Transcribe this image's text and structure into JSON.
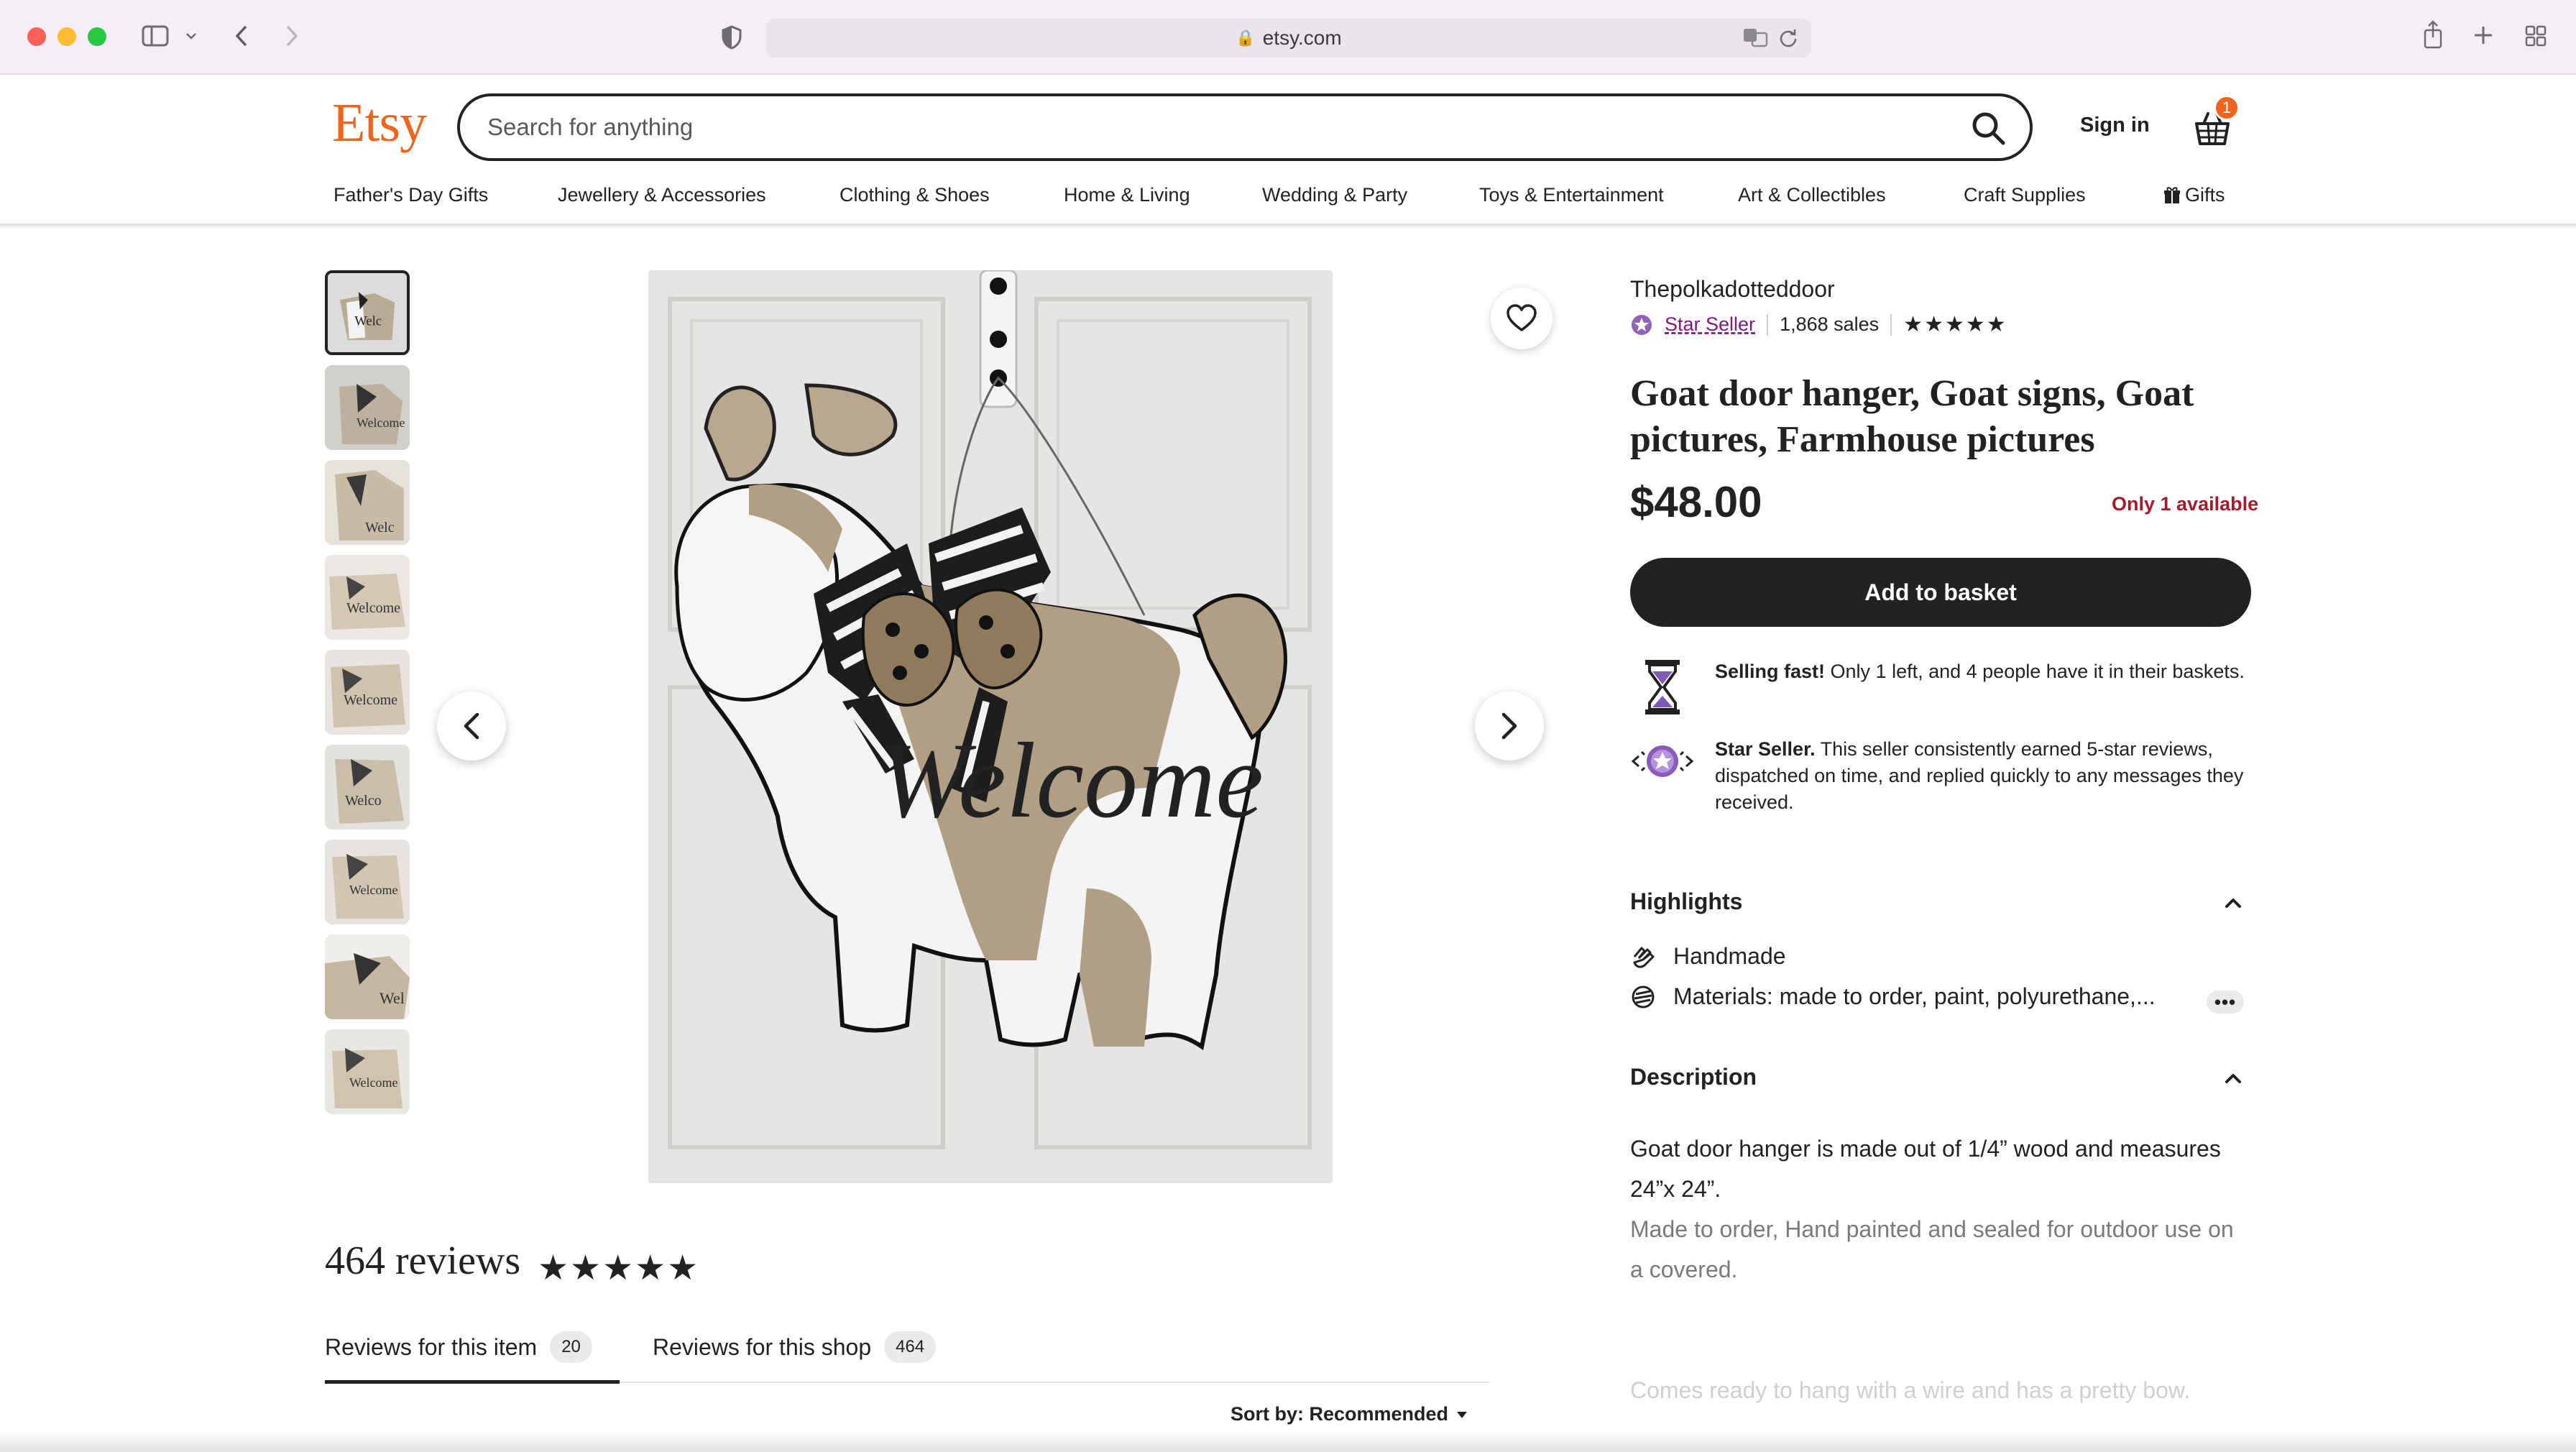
{
  "browser": {
    "url": "etsy.com"
  },
  "header": {
    "logo": "Etsy",
    "search_placeholder": "Search for anything",
    "sign_in": "Sign in",
    "cart_count": "1"
  },
  "categories": [
    "Father's Day Gifts",
    "Jewellery & Accessories",
    "Clothing & Shoes",
    "Home & Living",
    "Wedding & Party",
    "Toys & Entertainment",
    "Art & Collectibles",
    "Craft Supplies",
    "Gifts"
  ],
  "listing": {
    "shop_name": "Thepolkadotteddoor",
    "star_seller": "Star Seller",
    "sales": "1,868 sales",
    "rating_stars": "★★★★★",
    "title": "Goat door hanger, Goat signs, Goat pictures, Farmhouse pictures",
    "price": "$48.00",
    "availability": "Only 1 available",
    "add_to_basket": "Add to basket",
    "selling_fast_title": "Selling fast!",
    "selling_fast_text": " Only 1 left, and 4 people have it in their baskets.",
    "star_seller_title": "Star Seller.",
    "star_seller_text": " This seller consistently earned 5-star reviews, dispatched on time, and replied quickly to any messages they received.",
    "image_text": "Welcome"
  },
  "highlights": {
    "heading": "Highlights",
    "items": [
      "Handmade",
      "Materials: made to order, paint, polyurethane,..."
    ],
    "more": "•••"
  },
  "description": {
    "heading": "Description",
    "paragraphs": [
      "Goat door hanger is made out of 1/4” wood and measures 24”x 24”.",
      "Made to order, Hand painted and sealed for outdoor use on a covered.",
      "Comes ready to hang with a wire and has a pretty bow."
    ]
  },
  "reviews": {
    "title": "464 reviews",
    "stars": "★★★★★",
    "tabs": [
      {
        "label": "Reviews for this item",
        "count": "20"
      },
      {
        "label": "Reviews for this shop",
        "count": "464"
      }
    ],
    "sort_label": "Sort by: Recommended"
  },
  "colors": {
    "brand": "#f1641e",
    "star_seller": "#7f187f",
    "alert": "#a61a2e"
  },
  "icons": {
    "lock": "lock-icon",
    "translate": "translate-icon",
    "reload": "reload-icon",
    "share": "share-icon",
    "new_tab": "plus-icon",
    "tab_overview": "grid-icon",
    "search": "search-icon",
    "cart": "basket-icon",
    "favorite": "heart-icon",
    "hourglass": "hourglass-icon",
    "star_badge": "star-badge-icon",
    "handmade": "hand-icon",
    "materials": "layers-icon",
    "gift": "gift-icon"
  }
}
